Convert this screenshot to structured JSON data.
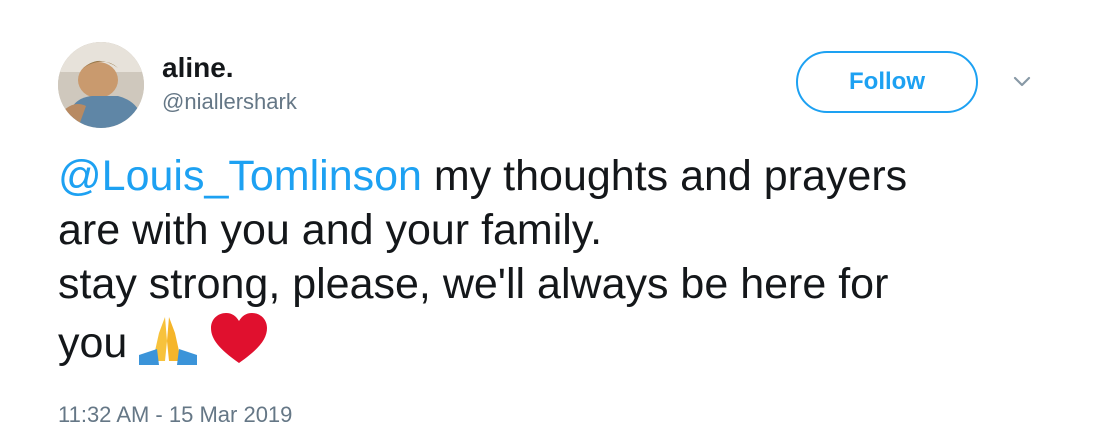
{
  "user": {
    "display_name": "aline.",
    "handle": "@niallershark"
  },
  "follow_button": {
    "label": "Follow"
  },
  "tweet": {
    "mention": "@Louis_Tomlinson",
    "line1_rest": " my thoughts and prayers",
    "line2": "are with you and your family.",
    "line3": "stay strong, please, we'll always be here for",
    "line4": "you",
    "emojis": [
      "folded-hands-icon",
      "red-heart-icon"
    ]
  },
  "timestamp": "11:32 AM - 15 Mar 2019",
  "colors": {
    "accent": "#1da1f2",
    "text": "#14171a",
    "secondary": "#657786",
    "heart": "#e0102e",
    "hands": "#f7c23c"
  }
}
